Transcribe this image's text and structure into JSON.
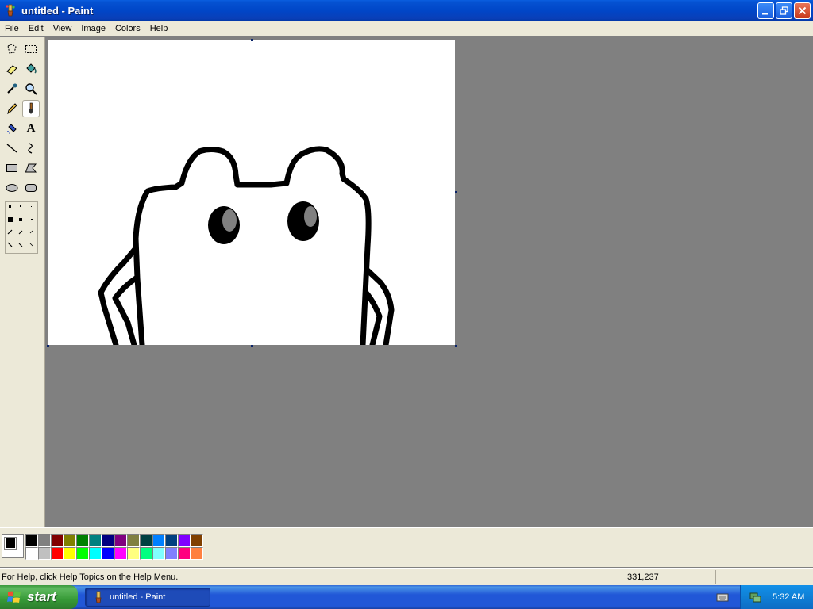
{
  "window": {
    "title": "untitled - Paint",
    "icons": {
      "app": "paint-brush-icon",
      "minimize": "minimize-icon",
      "restore": "restore-icon",
      "close": "close-icon"
    }
  },
  "menubar": {
    "items": [
      "File",
      "Edit",
      "View",
      "Image",
      "Colors",
      "Help"
    ]
  },
  "toolbox": {
    "tools": [
      {
        "name": "free-form-select",
        "icon": "free-select-icon"
      },
      {
        "name": "select",
        "icon": "rect-select-icon"
      },
      {
        "name": "eraser",
        "icon": "eraser-icon"
      },
      {
        "name": "fill",
        "icon": "fill-bucket-icon"
      },
      {
        "name": "pick-color",
        "icon": "eyedropper-icon"
      },
      {
        "name": "magnifier",
        "icon": "magnifier-icon"
      },
      {
        "name": "pencil",
        "icon": "pencil-icon"
      },
      {
        "name": "brush",
        "icon": "brush-icon",
        "selected": true
      },
      {
        "name": "airbrush",
        "icon": "airbrush-icon"
      },
      {
        "name": "text",
        "icon": "text-icon",
        "glyph": "A"
      },
      {
        "name": "line",
        "icon": "line-icon"
      },
      {
        "name": "curve",
        "icon": "curve-icon"
      },
      {
        "name": "rectangle",
        "icon": "rectangle-icon"
      },
      {
        "name": "polygon",
        "icon": "polygon-icon"
      },
      {
        "name": "ellipse",
        "icon": "ellipse-icon"
      },
      {
        "name": "rounded-rectangle",
        "icon": "rounded-rect-icon"
      }
    ]
  },
  "palette": {
    "foreground": "#000000",
    "background": "#ffffff",
    "colors": [
      "#000000",
      "#808080",
      "#800000",
      "#808000",
      "#008000",
      "#008080",
      "#000080",
      "#800080",
      "#808040",
      "#004040",
      "#0080ff",
      "#004080",
      "#8000ff",
      "#804000",
      "#ffffff",
      "#c0c0c0",
      "#ff0000",
      "#ffff00",
      "#00ff00",
      "#00ffff",
      "#0000ff",
      "#ff00ff",
      "#ffff80",
      "#00ff80",
      "#80ffff",
      "#8080ff",
      "#ff0080",
      "#ff8040"
    ]
  },
  "statusbar": {
    "help": "For Help, click Help Topics on the Help Menu.",
    "coords": "331,237",
    "extra": ""
  },
  "taskbar": {
    "start_label": "start",
    "task_label": "untitled - Paint",
    "time": "5:32 AM",
    "icons": {
      "start": "windows-logo-icon",
      "keyboard": "keyboard-icon",
      "tray": "network-icon"
    }
  },
  "colors": {
    "titlebar": "#0046c8",
    "face": "#ece9d8",
    "workspace": "#808080",
    "taskbar": "#2157d7",
    "start": "#379a37"
  }
}
